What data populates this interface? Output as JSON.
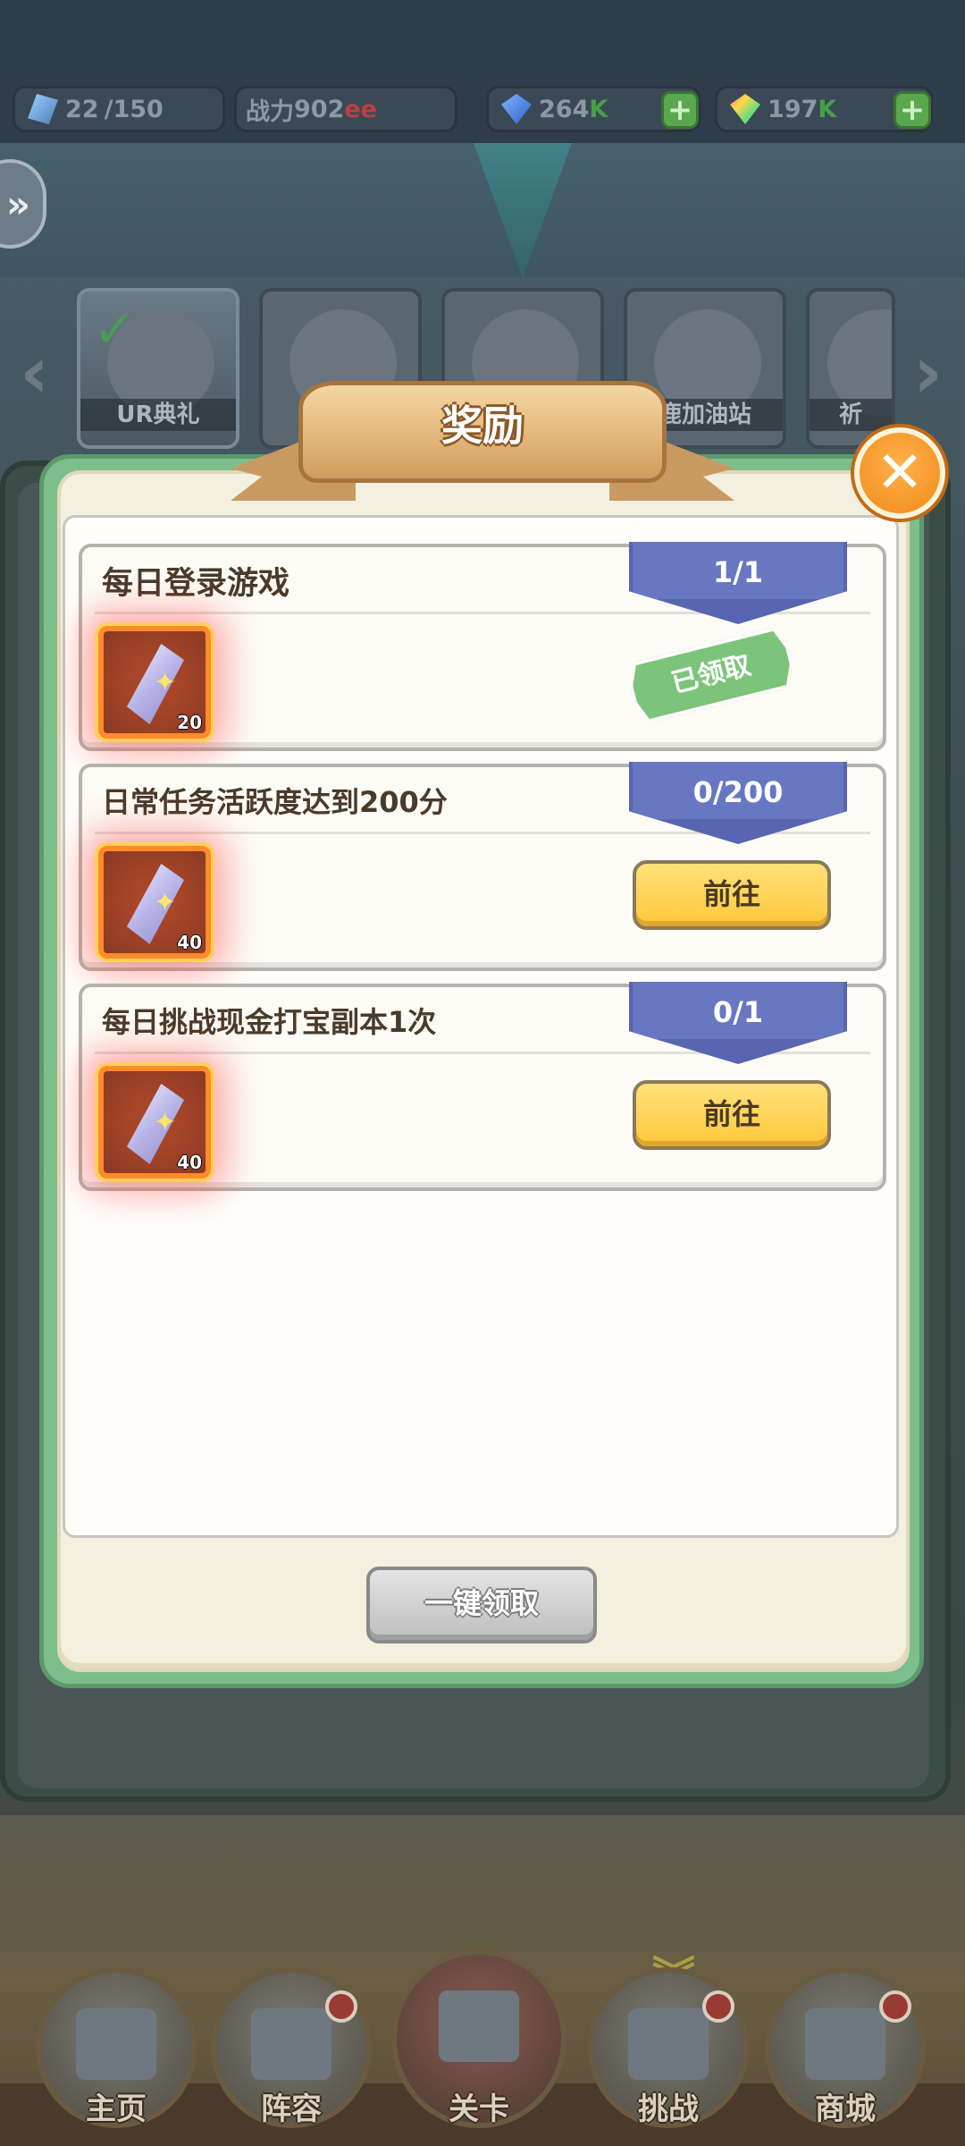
{
  "top_bar": {
    "crystals": {
      "value": "22",
      "max": "/150"
    },
    "power": {
      "label": "战力",
      "value": "902",
      "suffix": "ee"
    },
    "diamonds": {
      "value": "264",
      "suffix": "K"
    },
    "rainbow_gems": {
      "value": "197",
      "suffix": "K"
    },
    "plus_label": "+"
  },
  "side_button": {
    "label": "»"
  },
  "event_tabs": {
    "prev_arrow": "‹",
    "next_arrow": "›",
    "tabs": [
      {
        "label": "UR典礼",
        "active": true
      },
      {
        "label": ""
      },
      {
        "label": ""
      },
      {
        "label": "鹿加油站"
      },
      {
        "label": "祈"
      }
    ]
  },
  "modal": {
    "title": "奖励",
    "close_label": "✕",
    "tasks": [
      {
        "title": "每日登录游戏",
        "progress": "1/1",
        "reward_count": "20",
        "status": "已领取"
      },
      {
        "title": "日常任务活跃度达到200分",
        "progress": "0/200",
        "reward_count": "40",
        "action": "前往"
      },
      {
        "title": "每日挑战现金打宝副本1次",
        "progress": "0/1",
        "reward_count": "40",
        "action": "前往"
      }
    ],
    "claim_all": "一键领取"
  },
  "bottom_nav": {
    "items": [
      {
        "label": "主页"
      },
      {
        "label": "阵容"
      },
      {
        "label": "关卡"
      },
      {
        "label": "挑战"
      },
      {
        "label": "商城"
      }
    ],
    "chevron": "︾"
  },
  "colors": {
    "modal_border": "#7cbf8c",
    "progress_tag": "#6877c2",
    "go_button": "#ffc83a",
    "claimed_badge": "#7cc47a",
    "close_button": "#f18a1a"
  }
}
